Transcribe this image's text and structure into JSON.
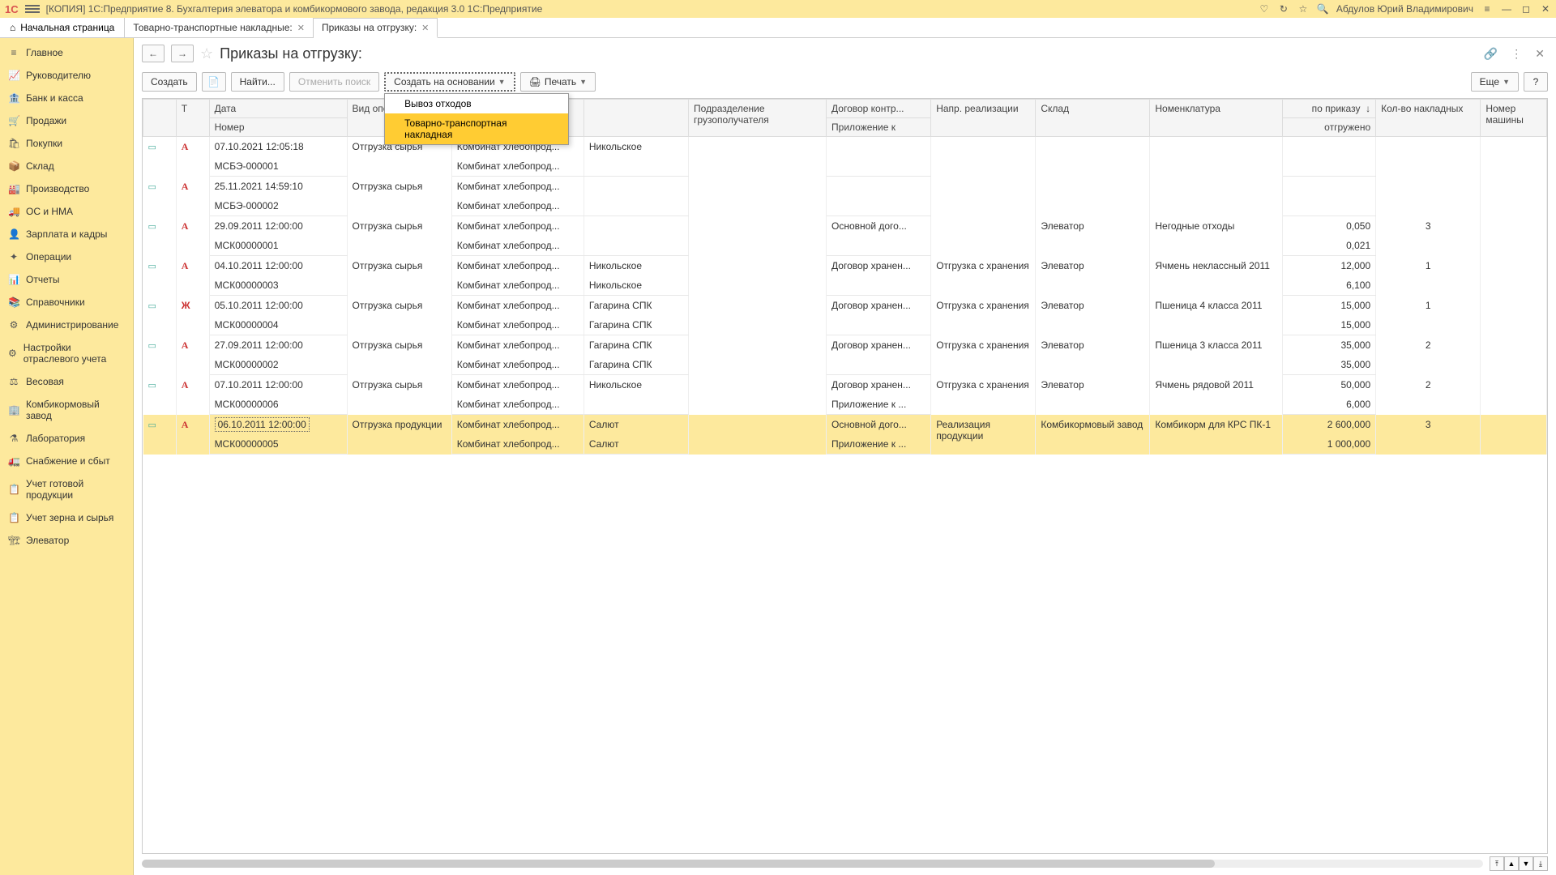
{
  "titlebar": {
    "logo": "1C",
    "title": "[КОПИЯ] 1С:Предприятие 8. Бухгалтерия элеватора и комбикормового завода, редакция 3.0 1С:Предприятие",
    "username": "Абдулов Юрий Владимирович"
  },
  "tabs": {
    "home": "Начальная страница",
    "items": [
      "Товарно-транспортные накладные:",
      "Приказы на отгрузку:"
    ],
    "active": 1
  },
  "sidebar": [
    {
      "icon": "≡",
      "label": "Главное"
    },
    {
      "icon": "📈",
      "label": "Руководителю"
    },
    {
      "icon": "🏦",
      "label": "Банк и касса"
    },
    {
      "icon": "🛒",
      "label": "Продажи"
    },
    {
      "icon": "🛍",
      "label": "Покупки"
    },
    {
      "icon": "📦",
      "label": "Склад"
    },
    {
      "icon": "🏭",
      "label": "Производство"
    },
    {
      "icon": "🚚",
      "label": "ОС и НМА"
    },
    {
      "icon": "👤",
      "label": "Зарплата и кадры"
    },
    {
      "icon": "✦",
      "label": "Операции"
    },
    {
      "icon": "📊",
      "label": "Отчеты"
    },
    {
      "icon": "📚",
      "label": "Справочники"
    },
    {
      "icon": "⚙",
      "label": "Администрирование"
    },
    {
      "icon": "⚙",
      "label": "Настройки отраслевого учета"
    },
    {
      "icon": "⚖",
      "label": "Весовая"
    },
    {
      "icon": "🏢",
      "label": "Комбикормовый завод"
    },
    {
      "icon": "⚗",
      "label": "Лаборатория"
    },
    {
      "icon": "🚛",
      "label": "Снабжение и сбыт"
    },
    {
      "icon": "📋",
      "label": "Учет готовой продукции"
    },
    {
      "icon": "📋",
      "label": "Учет зерна и сырья"
    },
    {
      "icon": "🏗",
      "label": "Элеватор"
    }
  ],
  "page": {
    "title": "Приказы на отгрузку:"
  },
  "toolbar": {
    "create": "Создать",
    "find": "Найти...",
    "cancel_find": "Отменить поиск",
    "create_based": "Создать на основании",
    "print": "Печать",
    "more": "Еще",
    "help": "?"
  },
  "dropdown": {
    "items": [
      "Вывоз отходов",
      "Товарно-транспортная накладная"
    ],
    "hover": 1
  },
  "columns": {
    "t": "Т",
    "date": "Дата",
    "number": "Номер",
    "op": "Вид операции",
    "col5a": "",
    "col5b": "",
    "dept": "Подразделение грузополучателя",
    "contract": "Договор контр...",
    "appendix": "Приложение к",
    "dir": "Напр. реализации",
    "store": "Склад",
    "nomen": "Номенклатура",
    "ordered": "по приказу",
    "shipped": "отгружено",
    "waybills": "Кол-во накладных",
    "car": "Номер машины"
  },
  "rows": [
    {
      "mark": "А",
      "date": "07.10.2021 12:05:18",
      "num": "МСБЭ-000001",
      "op": "Отгрузка сырья",
      "c1a": "Комбинат хлебопрод...",
      "c1b": "Комбинат хлебопрод...",
      "c2a": "Никольское",
      "c2b": "",
      "contract": "",
      "appendix": "",
      "dir": "",
      "store": "",
      "nomen": "",
      "ordered": "",
      "shipped": "",
      "wb": "",
      "car": ""
    },
    {
      "mark": "А",
      "date": "25.11.2021 14:59:10",
      "num": "МСБЭ-000002",
      "op": "Отгрузка сырья",
      "c1a": "Комбинат хлебопрод...",
      "c1b": "Комбинат хлебопрод...",
      "c2a": "",
      "c2b": "",
      "contract": "",
      "appendix": "",
      "dir": "",
      "store": "",
      "nomen": "",
      "ordered": "",
      "shipped": "",
      "wb": "",
      "car": ""
    },
    {
      "mark": "А",
      "date": "29.09.2011 12:00:00",
      "num": "МСК00000001",
      "op": "Отгрузка сырья",
      "c1a": "Комбинат хлебопрод...",
      "c1b": "Комбинат хлебопрод...",
      "c2a": "",
      "c2b": "",
      "contract": "Основной дого...",
      "appendix": "",
      "dir": "",
      "store": "Элеватор",
      "nomen": "Негодные отходы",
      "ordered": "0,050",
      "shipped": "0,021",
      "wb": "3",
      "car": ""
    },
    {
      "mark": "А",
      "date": "04.10.2011 12:00:00",
      "num": "МСК00000003",
      "op": "Отгрузка сырья",
      "c1a": "Комбинат хлебопрод...",
      "c1b": "Комбинат хлебопрод...",
      "c2a": "Никольское",
      "c2b": "Никольское",
      "contract": "Договор хранен...",
      "appendix": "",
      "dir": "Отгрузка с хранения",
      "store": "Элеватор",
      "nomen": "Ячмень неклассный 2011",
      "ordered": "12,000",
      "shipped": "6,100",
      "wb": "1",
      "car": ""
    },
    {
      "mark": "Ж",
      "date": "05.10.2011 12:00:00",
      "num": "МСК00000004",
      "op": "Отгрузка сырья",
      "c1a": "Комбинат хлебопрод...",
      "c1b": "Комбинат хлебопрод...",
      "c2a": "Гагарина СПК",
      "c2b": "Гагарина СПК",
      "contract": "Договор хранен...",
      "appendix": "",
      "dir": "Отгрузка с хранения",
      "store": "Элеватор",
      "nomen": "Пшеница 4 класса 2011",
      "ordered": "15,000",
      "shipped": "15,000",
      "wb": "1",
      "car": ""
    },
    {
      "mark": "А",
      "date": "27.09.2011 12:00:00",
      "num": "МСК00000002",
      "op": "Отгрузка сырья",
      "c1a": "Комбинат хлебопрод...",
      "c1b": "Комбинат хлебопрод...",
      "c2a": "Гагарина СПК",
      "c2b": "Гагарина СПК",
      "contract": "Договор хранен...",
      "appendix": "",
      "dir": "Отгрузка с хранения",
      "store": "Элеватор",
      "nomen": "Пшеница 3 класса 2011",
      "ordered": "35,000",
      "shipped": "35,000",
      "wb": "2",
      "car": ""
    },
    {
      "mark": "А",
      "date": "07.10.2011 12:00:00",
      "num": "МСК00000006",
      "op": "Отгрузка сырья",
      "c1a": "Комбинат хлебопрод...",
      "c1b": "Комбинат хлебопрод...",
      "c2a": "Никольское",
      "c2b": "",
      "contract": "Договор хранен...",
      "appendix": "Приложение к ...",
      "dir": "Отгрузка с хранения",
      "store": "Элеватор",
      "nomen": "Ячмень рядовой 2011",
      "ordered": "50,000",
      "shipped": "6,000",
      "wb": "2",
      "car": ""
    },
    {
      "mark": "А",
      "date": "06.10.2011 12:00:00",
      "num": "МСК00000005",
      "op": "Отгрузка продукции",
      "c1a": "Комбинат хлебопрод...",
      "c1b": "Комбинат хлебопрод...",
      "c2a": "Салют",
      "c2b": "Салют",
      "contract": "Основной дого...",
      "appendix": "Приложение к ...",
      "dir": "Реализация продукции",
      "store": "Комбикормовый завод",
      "nomen": "Комбикорм для КРС ПК-1",
      "ordered": "2 600,000",
      "shipped": "1 000,000",
      "wb": "3",
      "car": "",
      "selected": true
    }
  ]
}
